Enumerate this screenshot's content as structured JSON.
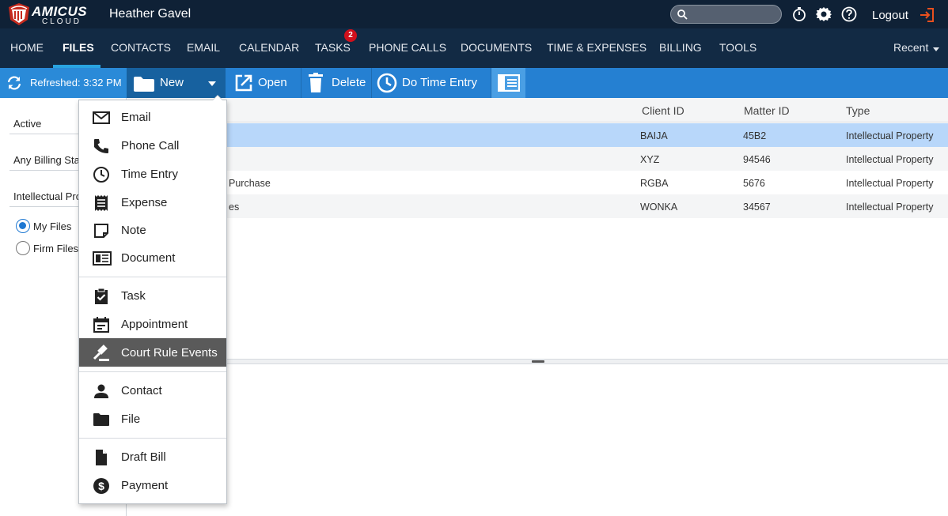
{
  "app": {
    "logo_primary": "AMICUS",
    "logo_secondary": "CLOUD",
    "user_name": "Heather Gavel",
    "search_placeholder": "",
    "logout_label": "Logout"
  },
  "nav": {
    "items": [
      {
        "label": "HOME"
      },
      {
        "label": "FILES",
        "active": true
      },
      {
        "label": "CONTACTS"
      },
      {
        "label": "EMAIL"
      },
      {
        "label": "CALENDAR"
      },
      {
        "label": "TASKS",
        "badge": "2"
      },
      {
        "label": "PHONE CALLS"
      },
      {
        "label": "DOCUMENTS"
      },
      {
        "label": "TIME & EXPENSES"
      },
      {
        "label": "BILLING"
      },
      {
        "label": "TOOLS"
      }
    ],
    "recent_label": "Recent"
  },
  "toolbar": {
    "refreshed_label": "Refreshed: 3:32 PM",
    "new_label": "New",
    "open_label": "Open",
    "delete_label": "Delete",
    "time_entry_label": "Do Time Entry"
  },
  "filters": {
    "status": "Active",
    "billing": "Any Billing Status",
    "type": "Intellectual Property",
    "radios": [
      {
        "label": "My Files",
        "checked": true
      },
      {
        "label": "Firm Files",
        "checked": false
      }
    ]
  },
  "table": {
    "columns": [
      "Client ID",
      "Matter ID",
      "Type"
    ],
    "rows": [
      {
        "name": "",
        "client_id": "BAIJA",
        "matter_id": "45B2",
        "type": "Intellectual Property",
        "selected": true
      },
      {
        "name": "",
        "client_id": "XYZ",
        "matter_id": "94546",
        "type": "Intellectual Property"
      },
      {
        "name": "Purchase",
        "client_id": "RGBA",
        "matter_id": "5676",
        "type": "Intellectual Property"
      },
      {
        "name": "es",
        "client_id": "WONKA",
        "matter_id": "34567",
        "type": "Intellectual Property"
      }
    ]
  },
  "new_menu": {
    "items": [
      {
        "label": "Email",
        "icon": "mail-icon"
      },
      {
        "label": "Phone Call",
        "icon": "phone-icon"
      },
      {
        "label": "Time Entry",
        "icon": "clock-icon"
      },
      {
        "label": "Expense",
        "icon": "receipt-icon"
      },
      {
        "label": "Note",
        "icon": "note-icon"
      },
      {
        "label": "Document",
        "icon": "document-icon"
      },
      {
        "label": "Task",
        "icon": "task-check-icon"
      },
      {
        "label": "Appointment",
        "icon": "calendar-icon"
      },
      {
        "label": "Court Rule Events",
        "icon": "gavel-icon",
        "highlighted": true
      },
      {
        "label": "Contact",
        "icon": "person-icon"
      },
      {
        "label": "File",
        "icon": "folder-icon"
      },
      {
        "label": "Draft Bill",
        "icon": "bill-icon"
      },
      {
        "label": "Payment",
        "icon": "dollar-icon"
      }
    ]
  },
  "colors": {
    "header_bg": "#0f2136",
    "nav_bg": "#122a44",
    "toolbar_bg": "#2580d2",
    "accent": "#29a3e0",
    "selected_row": "#b8d7fa",
    "highlight_menu": "#5a5a5a",
    "logout_icon": "#e8501e"
  }
}
